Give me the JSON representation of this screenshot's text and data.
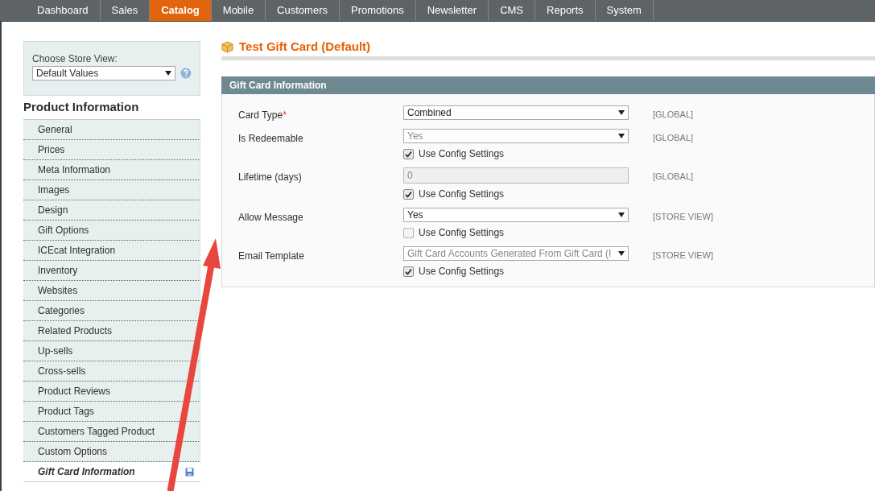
{
  "nav": [
    {
      "label": "Dashboard",
      "selected": false
    },
    {
      "label": "Sales",
      "selected": false
    },
    {
      "label": "Catalog",
      "selected": true
    },
    {
      "label": "Mobile",
      "selected": false
    },
    {
      "label": "Customers",
      "selected": false
    },
    {
      "label": "Promotions",
      "selected": false
    },
    {
      "label": "Newsletter",
      "selected": false
    },
    {
      "label": "CMS",
      "selected": false
    },
    {
      "label": "Reports",
      "selected": false
    },
    {
      "label": "System",
      "selected": false
    }
  ],
  "store_view": {
    "label": "Choose Store View:",
    "value": "Default Values"
  },
  "sidebar": {
    "title": "Product Information",
    "items": [
      {
        "label": "General",
        "selected": false
      },
      {
        "label": "Prices",
        "selected": false
      },
      {
        "label": "Meta Information",
        "selected": false
      },
      {
        "label": "Images",
        "selected": false
      },
      {
        "label": "Design",
        "selected": false
      },
      {
        "label": "Gift Options",
        "selected": false
      },
      {
        "label": "ICEcat Integration",
        "selected": false
      },
      {
        "label": "Inventory",
        "selected": false
      },
      {
        "label": "Websites",
        "selected": false
      },
      {
        "label": "Categories",
        "selected": false
      },
      {
        "label": "Related Products",
        "selected": false
      },
      {
        "label": "Up-sells",
        "selected": false
      },
      {
        "label": "Cross-sells",
        "selected": false
      },
      {
        "label": "Product Reviews",
        "selected": false
      },
      {
        "label": "Product Tags",
        "selected": false
      },
      {
        "label": "Customers Tagged Product",
        "selected": false
      },
      {
        "label": "Custom Options",
        "selected": false
      },
      {
        "label": "Gift Card Information",
        "selected": true
      }
    ]
  },
  "page_title": "Test Gift Card (Default)",
  "section": {
    "title": "Gift Card Information",
    "fields": [
      {
        "label": "Card Type",
        "required_mark": "*",
        "kind": "select",
        "value": "Combined",
        "disabled": false,
        "scope": "[GLOBAL]"
      },
      {
        "label": "Is Redeemable",
        "kind": "select",
        "value": "Yes",
        "disabled": true,
        "scope": "[GLOBAL]",
        "config": {
          "label": "Use Config Settings",
          "checked": true
        }
      },
      {
        "label": "Lifetime (days)",
        "kind": "text",
        "value": "0",
        "disabled": true,
        "scope": "[GLOBAL]",
        "config": {
          "label": "Use Config Settings",
          "checked": true
        }
      },
      {
        "label": "Allow Message",
        "kind": "select",
        "value": "Yes",
        "disabled": false,
        "scope": "[STORE VIEW]",
        "config": {
          "label": "Use Config Settings",
          "checked": false
        }
      },
      {
        "label": "Email Template",
        "kind": "select",
        "value": "Gift Card Accounts Generated From Gift Card (I",
        "disabled": true,
        "scope": "[STORE VIEW]",
        "config": {
          "label": "Use Config Settings",
          "checked": true
        }
      }
    ]
  }
}
